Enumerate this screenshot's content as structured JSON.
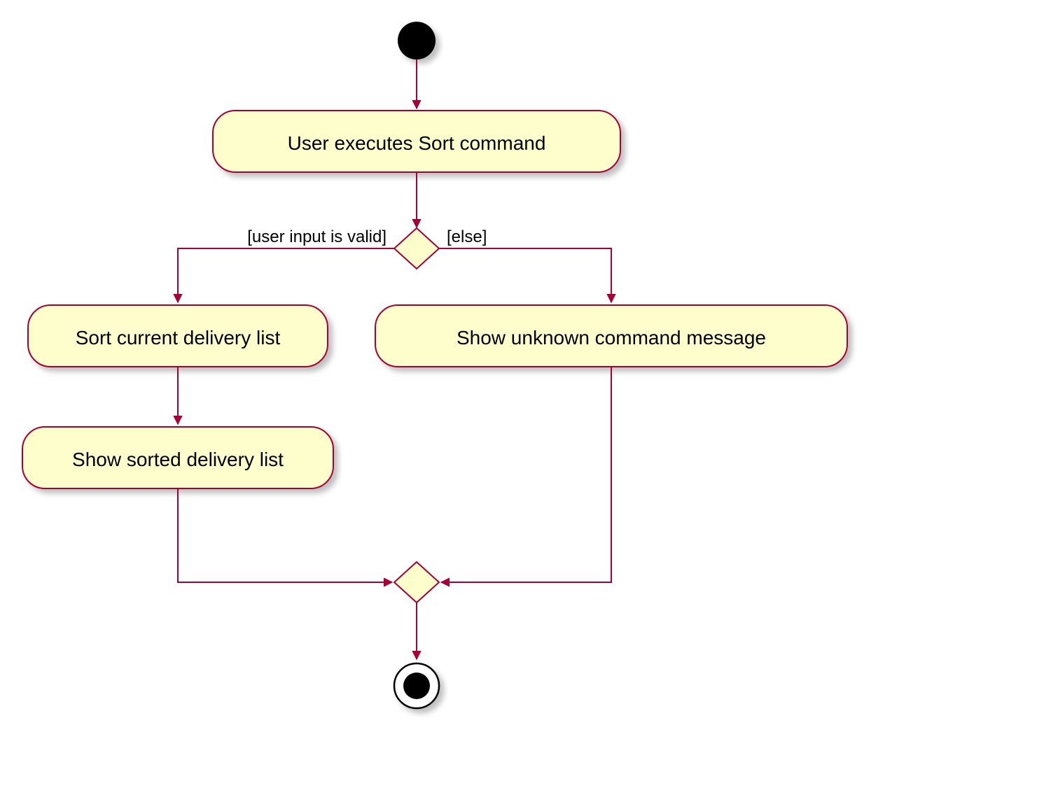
{
  "uml": {
    "type": "activity_diagram",
    "nodes": {
      "initial": {
        "kind": "initial"
      },
      "a1": {
        "kind": "activity",
        "label": "User executes Sort command"
      },
      "decision1": {
        "kind": "decision"
      },
      "a2": {
        "kind": "activity",
        "label": "Sort current delivery list"
      },
      "a3": {
        "kind": "activity",
        "label": "Show sorted delivery list"
      },
      "a4": {
        "kind": "activity",
        "label": "Show unknown command message"
      },
      "merge1": {
        "kind": "merge"
      },
      "final": {
        "kind": "final"
      }
    },
    "edges": [
      {
        "from": "initial",
        "to": "a1"
      },
      {
        "from": "a1",
        "to": "decision1"
      },
      {
        "from": "decision1",
        "to": "a2",
        "guard": "[user input is valid]"
      },
      {
        "from": "decision1",
        "to": "a4",
        "guard": "[else]"
      },
      {
        "from": "a2",
        "to": "a3"
      },
      {
        "from": "a3",
        "to": "merge1"
      },
      {
        "from": "a4",
        "to": "merge1"
      },
      {
        "from": "merge1",
        "to": "final"
      }
    ]
  },
  "colors": {
    "fill": "#fefecd",
    "stroke": "#a80036",
    "initial_fill": "#000000"
  }
}
